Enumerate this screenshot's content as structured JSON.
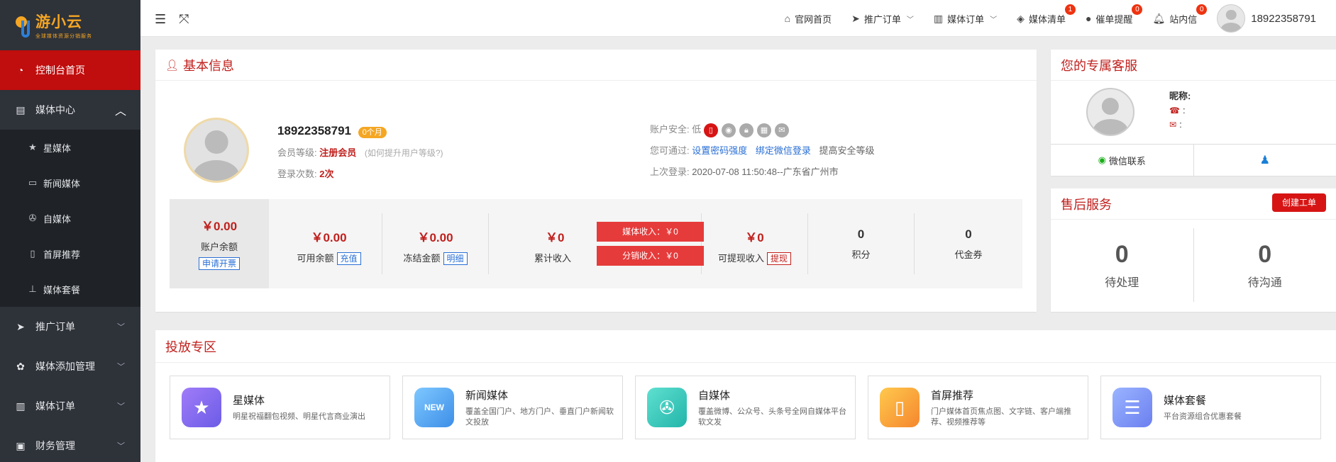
{
  "brand": {
    "name": "游小云",
    "tagline": "全球媒体资源分销服务"
  },
  "sidebar": {
    "items": [
      {
        "label": "控制台首页",
        "icon": "dashboard-icon",
        "active": true
      },
      {
        "label": "媒体中心",
        "icon": "document-icon",
        "open": true
      },
      {
        "label": "推广订单",
        "icon": "paper-plane-icon"
      },
      {
        "label": "媒体添加管理",
        "icon": "paw-icon"
      },
      {
        "label": "媒体订单",
        "icon": "bar-chart-icon"
      },
      {
        "label": "财务管理",
        "icon": "wallet-icon"
      }
    ],
    "sub_items": [
      {
        "label": "星媒体",
        "icon": "star-icon"
      },
      {
        "label": "新闻媒体",
        "icon": "news-icon"
      },
      {
        "label": "自媒体",
        "icon": "film-reel-icon"
      },
      {
        "label": "首屏推荐",
        "icon": "mobile-icon"
      },
      {
        "label": "媒体套餐",
        "icon": "bar-icon"
      }
    ]
  },
  "topbar": {
    "home": "官网首页",
    "promo_orders": "推广订单",
    "media_orders": "媒体订单",
    "media_list": "媒体清单",
    "media_list_badge": "1",
    "reminders": "催单提醒",
    "reminders_badge": "0",
    "messages": "站内信",
    "messages_badge": "0",
    "username": "18922358791"
  },
  "basic_info": {
    "title": "基本信息",
    "phone": "18922358791",
    "month_tag": "0个月",
    "level_label": "会员等级:",
    "level_value": "注册会员",
    "level_hint": "(如何提升用户等级?)",
    "login_label": "登录次数:",
    "login_value": "2次",
    "security_label": "账户安全:",
    "security_value": "低",
    "through_label": "您可通过:",
    "link_password": "设置密码强度",
    "link_wechat": "绑定微信登录",
    "through_suffix": "提高安全等级",
    "last_login_label": "上次登录:",
    "last_login_value": "2020-07-08 11:50:48--广东省广州市"
  },
  "stats": {
    "balance": {
      "value": "￥0.00",
      "label": "账户余额",
      "button": "申请开票"
    },
    "available": {
      "value": "￥0.00",
      "label": "可用余额",
      "button": "充值"
    },
    "frozen": {
      "value": "￥0.00",
      "label": "冻结金额",
      "button": "明细"
    },
    "total_income": {
      "value": "￥0",
      "label": "累计收入"
    },
    "media_income": "媒体收入：￥0",
    "dist_income": "分销收入：￥0",
    "withdrawable": {
      "value": "￥0",
      "label": "可提现收入",
      "button": "提现"
    },
    "points": {
      "value": "0",
      "label": "积分"
    },
    "vouchers": {
      "value": "0",
      "label": "代金券"
    }
  },
  "service": {
    "title": "您的专属客服",
    "nickname_label": "昵称:",
    "phone_label": ":",
    "mail_label": ":",
    "wechat": "微信联系"
  },
  "after_sales": {
    "title": "售后服务",
    "create_button": "创建工单",
    "pending": {
      "value": "0",
      "label": "待处理"
    },
    "communicate": {
      "value": "0",
      "label": "待沟通"
    }
  },
  "zone": {
    "title": "投放专区",
    "cards": [
      {
        "name": "星媒体",
        "desc": "明星祝福翻包视频、明星代言商业演出",
        "color": "#8c6cf0"
      },
      {
        "name": "新闻媒体",
        "desc": "覆盖全国门户、地方门户、垂直门户新闻软文投放",
        "color": "#4aa3f0"
      },
      {
        "name": "自媒体",
        "desc": "覆盖微博、公众号、头条号全网自媒体平台软文发",
        "color": "#3cc8c0"
      },
      {
        "name": "首屏推荐",
        "desc": "门户媒体首页焦点图、文字链、客户端推荐、视频推荐等",
        "color": "#f5a623"
      },
      {
        "name": "媒体套餐",
        "desc": "平台资源组合优惠套餐",
        "color": "#6c8cf0"
      }
    ]
  }
}
